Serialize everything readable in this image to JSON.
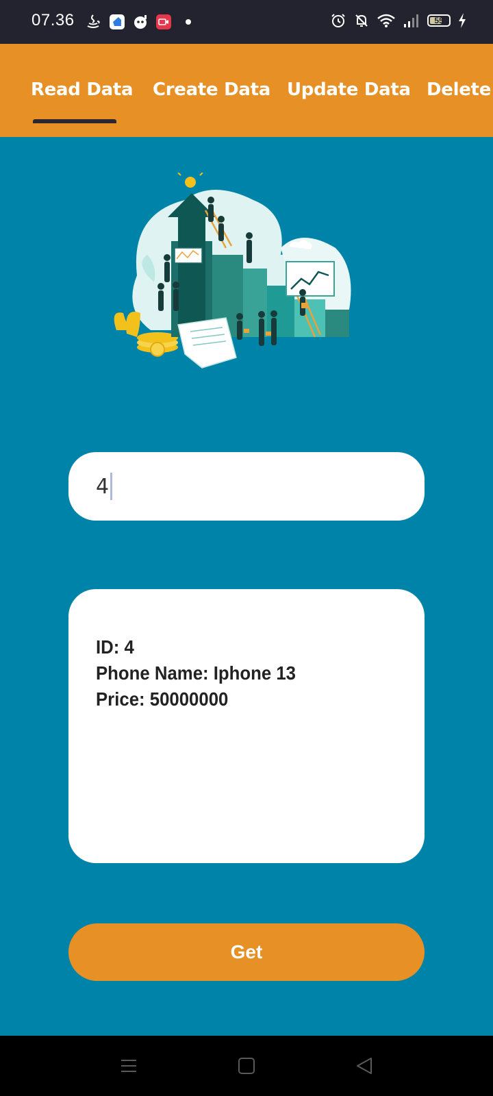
{
  "status_bar": {
    "time": "07.36",
    "battery": "55"
  },
  "tabs": [
    {
      "label": "Read Data",
      "active": true
    },
    {
      "label": "Create Data",
      "active": false
    },
    {
      "label": "Update Data",
      "active": false
    },
    {
      "label": "Delete D",
      "active": false
    }
  ],
  "id_input": {
    "value": "4"
  },
  "result": {
    "lines": [
      "ID: 4",
      "Phone Name: Iphone 13",
      "Price: 50000000"
    ]
  },
  "get_button": {
    "label": "Get"
  },
  "colors": {
    "background": "#0083a8",
    "accent": "#e69026",
    "status_bar": "#23232f",
    "indicator": "#2b2730"
  },
  "icons": {
    "status_left": [
      "java-icon",
      "app-icon",
      "bot-icon",
      "video-icon",
      "dot-icon"
    ],
    "status_right": [
      "alarm-icon",
      "bell-off-icon",
      "wifi-icon",
      "signal-icon",
      "battery-icon",
      "charging-icon"
    ],
    "nav": [
      "menu-icon",
      "home-icon",
      "back-icon"
    ]
  }
}
